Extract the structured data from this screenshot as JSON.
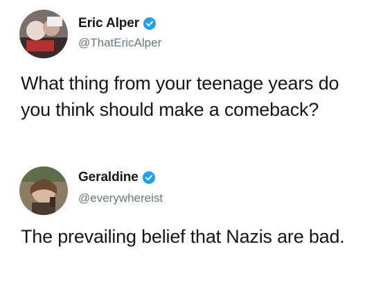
{
  "tweets": [
    {
      "author": {
        "display_name": "Eric Alper",
        "handle": "@ThatEricAlper",
        "verified": true,
        "avatar_icon": "profile-photo"
      },
      "text": "What thing from your teenage years do you think should make a comeback?"
    },
    {
      "author": {
        "display_name": "Geraldine",
        "handle": "@everywhereist",
        "verified": true,
        "avatar_icon": "profile-photo"
      },
      "text": "The prevailing belief that Nazis are bad."
    }
  ],
  "colors": {
    "verified_badge": "#1da1f2",
    "text_primary": "#14171a",
    "text_secondary": "#657786",
    "background": "#ffffff"
  }
}
